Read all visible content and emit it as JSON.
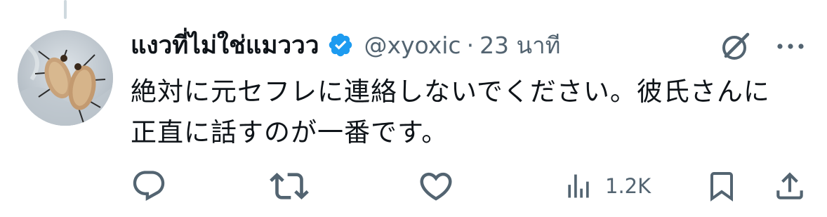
{
  "tweet": {
    "display_name": "แงวที่ไม่ใช่แมววว",
    "handle": "@xyoxic",
    "separator": "·",
    "time": "23 นาที",
    "text_line1": "絶対に元セフレに連絡しないでください。彼氏さんに",
    "text_line2": "正直に話すのが一番です。",
    "verified": true
  },
  "actions": {
    "views_count": "1.2K"
  },
  "icons": {
    "reply": "reply-icon",
    "retweet": "retweet-icon",
    "like": "heart-icon",
    "views": "views-icon",
    "bookmark": "bookmark-icon",
    "share": "share-icon",
    "grok": "grok-icon",
    "more": "more-icon",
    "verified": "verified-badge-icon"
  },
  "colors": {
    "text": "#0f1419",
    "secondary": "#536471",
    "verified": "#1d9bf0",
    "thread_line": "#cfd9de"
  }
}
